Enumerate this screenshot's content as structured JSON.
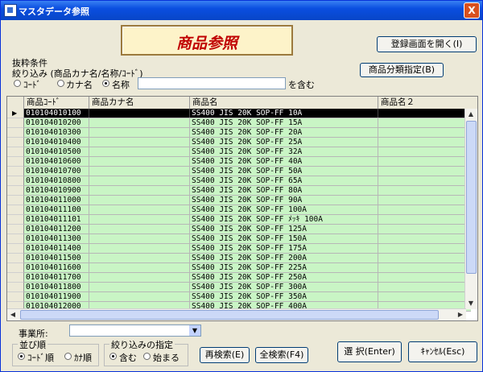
{
  "window": {
    "title": "マスタデータ参照",
    "close_label": "X"
  },
  "banner": {
    "text": "商品参照"
  },
  "buttons": {
    "open_register": "登録画面を開く(I)",
    "category": "商品分類指定(B)",
    "research": "再検索(E)",
    "search_all": "全検索(F4)",
    "select": "選 択(Enter)",
    "cancel": "ｷｬﾝｾﾙ(Esc)"
  },
  "filter": {
    "section_label": "抜粋条件",
    "narrow_label": "絞り込み (商品カナ名/名称/ｺｰﾄﾞ)",
    "options": [
      "ｺｰﾄﾞ",
      "カナ名",
      "名称"
    ],
    "selected_option": "名称",
    "search_value": "",
    "suffix": "を含む"
  },
  "table": {
    "columns": [
      "商品ｺｰﾄﾞ",
      "商品カナ名",
      "商品名",
      "商品名２"
    ],
    "rows": [
      [
        "010104010100",
        "",
        "SS400 JIS 20K SOP-FF 10A",
        ""
      ],
      [
        "010104010200",
        "",
        "SS400 JIS 20K SOP-FF 15A",
        ""
      ],
      [
        "010104010300",
        "",
        "SS400 JIS 20K SOP-FF 20A",
        ""
      ],
      [
        "010104010400",
        "",
        "SS400 JIS 20K SOP-FF 25A",
        ""
      ],
      [
        "010104010500",
        "",
        "SS400 JIS 20K SOP-FF 32A",
        ""
      ],
      [
        "010104010600",
        "",
        "SS400 JIS 20K SOP-FF 40A",
        ""
      ],
      [
        "010104010700",
        "",
        "SS400 JIS 20K SOP-FF 50A",
        ""
      ],
      [
        "010104010800",
        "",
        "SS400 JIS 20K SOP-FF 65A",
        ""
      ],
      [
        "010104010900",
        "",
        "SS400 JIS 20K SOP-FF 80A",
        ""
      ],
      [
        "010104011000",
        "",
        "SS400 JIS 20K SOP-FF 90A",
        ""
      ],
      [
        "010104011100",
        "",
        "SS400 JIS 20K SOP-FF 100A",
        ""
      ],
      [
        "010104011101",
        "",
        "SS400 JIS 20K SOP-FF ﾒｯｷ  100A",
        ""
      ],
      [
        "010104011200",
        "",
        "SS400 JIS 20K SOP-FF 125A",
        ""
      ],
      [
        "010104011300",
        "",
        "SS400 JIS 20K SOP-FF 150A",
        ""
      ],
      [
        "010104011400",
        "",
        "SS400 JIS 20K SOP-FF 175A",
        ""
      ],
      [
        "010104011500",
        "",
        "SS400 JIS 20K SOP-FF 200A",
        ""
      ],
      [
        "010104011600",
        "",
        "SS400 JIS 20K SOP-FF 225A",
        ""
      ],
      [
        "010104011700",
        "",
        "SS400 JIS 20K SOP-FF 250A",
        ""
      ],
      [
        "010104011800",
        "",
        "SS400 JIS 20K SOP-FF 300A",
        ""
      ],
      [
        "010104011900",
        "",
        "SS400 JIS 20K SOP-FF 350A",
        ""
      ],
      [
        "010104012000",
        "",
        "SS400 JIS 20K SOP-FF 400A",
        ""
      ]
    ],
    "selected_row": 0
  },
  "office": {
    "label": "事業所:",
    "value": ""
  },
  "sort": {
    "label": "並び順",
    "options": [
      "ｺｰﾄﾞ順",
      "ｶﾅ順"
    ],
    "selected": "ｺｰﾄﾞ順"
  },
  "match": {
    "label": "絞り込みの指定",
    "options": [
      "含む",
      "始まる"
    ],
    "selected": "含む"
  },
  "colors": {
    "row_bg": "#c9f5c5",
    "selected_row_bg": "#000000",
    "banner_text": "#c00000",
    "banner_bg": "#fdf3c9"
  }
}
